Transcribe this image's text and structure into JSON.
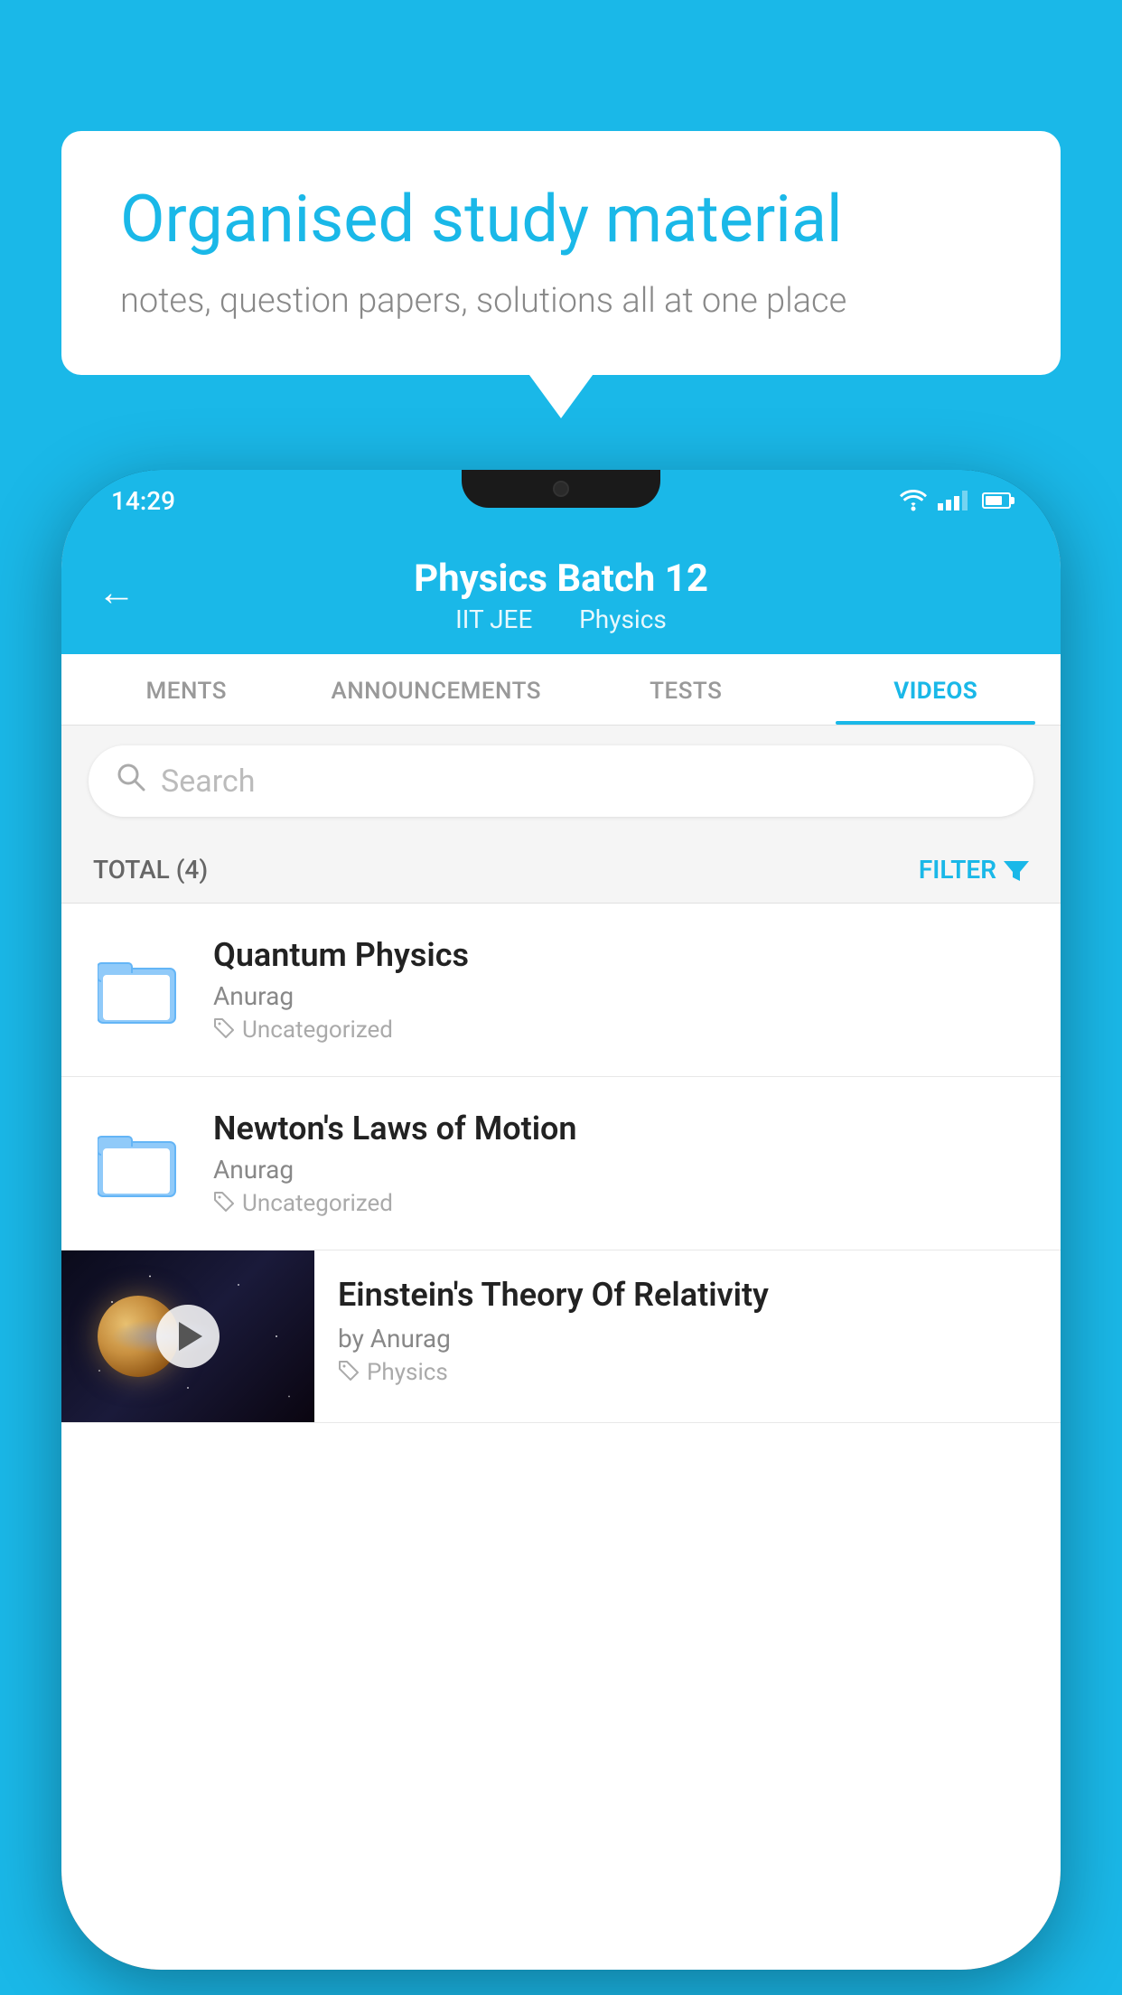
{
  "app": {
    "background_color": "#1ab8e8"
  },
  "speech_bubble": {
    "title": "Organised study material",
    "subtitle": "notes, question papers, solutions all at one place"
  },
  "status_bar": {
    "time": "14:29"
  },
  "app_header": {
    "title": "Physics Batch 12",
    "subtitle_part1": "IIT JEE",
    "subtitle_part2": "Physics",
    "back_label": "←"
  },
  "tabs": [
    {
      "label": "MENTS",
      "active": false
    },
    {
      "label": "ANNOUNCEMENTS",
      "active": false
    },
    {
      "label": "TESTS",
      "active": false
    },
    {
      "label": "VIDEOS",
      "active": true
    }
  ],
  "search": {
    "placeholder": "Search"
  },
  "filter_bar": {
    "total_label": "TOTAL (4)",
    "filter_label": "FILTER"
  },
  "videos": [
    {
      "title": "Quantum Physics",
      "author": "Anurag",
      "tag": "Uncategorized",
      "type": "folder"
    },
    {
      "title": "Newton's Laws of Motion",
      "author": "Anurag",
      "tag": "Uncategorized",
      "type": "folder"
    },
    {
      "title": "Einstein's Theory Of Relativity",
      "author": "by Anurag",
      "tag": "Physics",
      "type": "video"
    }
  ]
}
